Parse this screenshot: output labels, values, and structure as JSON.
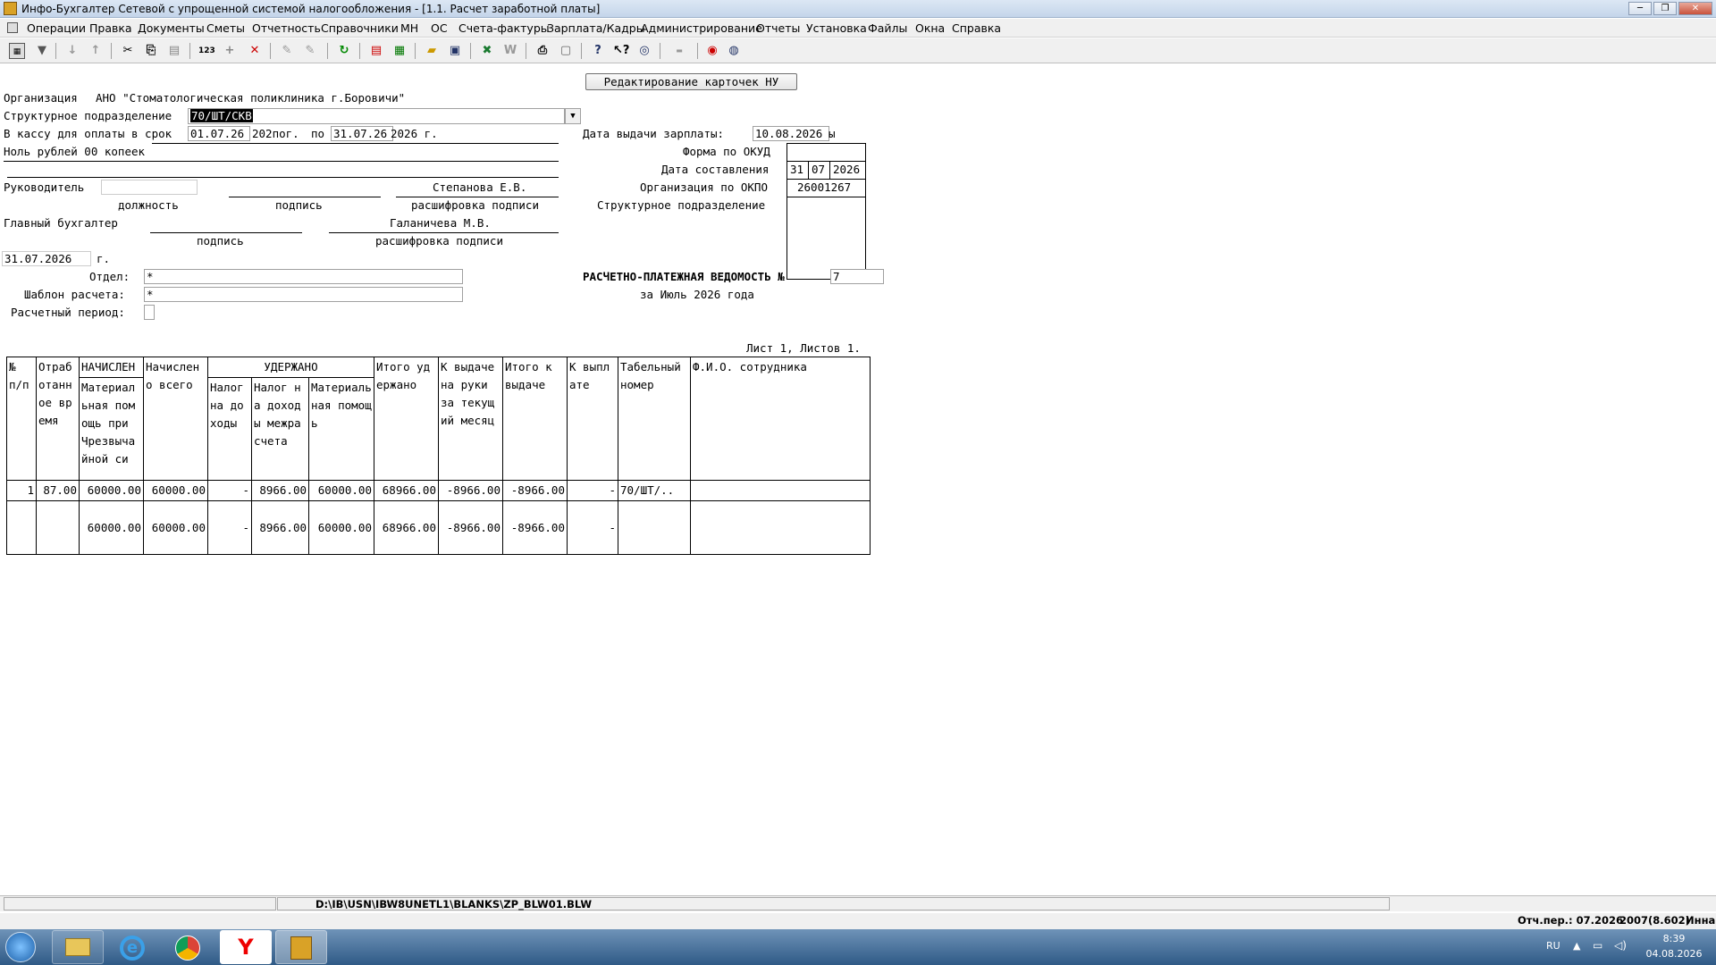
{
  "window": {
    "title": "Инфо-Бухгалтер Сетевой с упрощенной системой налогообложения - [1.1. Расчет заработной платы]",
    "minimize": "─",
    "restore": "❐",
    "close": "✕"
  },
  "menu": [
    "Операции",
    "Правка",
    "Документы",
    "Сметы",
    "Отчетность",
    "Справочники",
    "МН",
    "ОС",
    "Счета-фактуры",
    "Зарплата/Кадры",
    "Администрирование",
    "Отчеты",
    "Установка",
    "Файлы",
    "Окна",
    "Справка"
  ],
  "form": {
    "button_edit_cards": "Редактирование карточек НУ",
    "org_label": "Организация",
    "org_value": "АНО \"Стоматологическая поликлиника г.Боровичи\"",
    "dept_label": "Структурное подразделение",
    "dept_value": "70/ШТ/СКВ",
    "cash_label": "В кассу для оплаты в срок",
    "date_from": "01.07.26",
    "year_from": "202пог.",
    "po": "по",
    "date_to": "31.07.26",
    "year_to": "2026 г.",
    "amount_words": "Ноль рублей 00 копеек",
    "pay_date_label": "Дата выдачи зарплаты:",
    "pay_date": "10.08.2026",
    "pay_date_tail": "ы",
    "okud_label": "Форма по ОКУД",
    "date_comp_label": "Дата составления",
    "date_comp_d": "31",
    "date_comp_m": "07",
    "date_comp_y": "2026",
    "okpo_label": "Организация по ОКПО",
    "okpo_value": "26001267",
    "struct_label": "Структурное подразделение",
    "head_label": "Руководитель",
    "head_name": "Степанова Е.В.",
    "position_cap": "должность",
    "signature_cap": "подпись",
    "decode_cap": "расшифровка подписи",
    "chief_label": "Главный бухгалтер",
    "chief_name": "Галаничева М.В.",
    "signature_cap2": "подпись",
    "decode_cap2": "расшифровка подписи",
    "sign_date": "31.07.2026",
    "sign_date_g": "г.",
    "otdel_label": "Отдел:",
    "otdel_value": "*",
    "template_label": "Шаблон расчета:",
    "template_value": "*",
    "period_label": "Расчетный период:",
    "statement_title": "РАСЧЕТНО-ПЛАТЕЖНАЯ ВЕДОМОСТЬ №",
    "statement_no": "7",
    "statement_period": "за Июль 2026 года",
    "sheet_info": "Лист 1, Листов 1."
  },
  "table": {
    "h_no": "№ п/п",
    "h_worked": "Отработанное время",
    "h_accrued": "НАЧИСЛЕН",
    "h_matpom": "Материальная помощь при Чрезвычайной си",
    "h_accrued_total": "Начислено всего",
    "h_withheld": "УДЕРЖАНО",
    "h_tax1": "Налог на доходы",
    "h_tax2": "Налог на доходы межрасчета",
    "h_matpom2": "Материальная помощь",
    "h_withheld_total": "Итого удержано",
    "h_to_pay": "К выдаче на руки за текущий месяц",
    "h_total_pay": "Итого к выдаче",
    "h_paid": "К выплате",
    "h_tabno": "Табельный номер",
    "h_fio": "Ф.И.О. сотрудника",
    "row": [
      "1",
      "87.00",
      "60000.00",
      "60000.00",
      "-",
      "8966.00",
      "60000.00",
      "68966.00",
      "-8966.00",
      "-8966.00",
      "-",
      "70/ШТ/..",
      ""
    ],
    "total": [
      "",
      "",
      "60000.00",
      "60000.00",
      "-",
      "8966.00",
      "60000.00",
      "68966.00",
      "-8966.00",
      "-8966.00",
      "-",
      "",
      ""
    ]
  },
  "status": {
    "path": "D:\\IB\\USN\\IBW8UNETL1\\BLANKS\\ZP_BLW01.BLW",
    "period": "Отч.пер.: 07.2026",
    "version": "2007(8.602)",
    "user": "Инна"
  },
  "taskbar": {
    "lang": "RU",
    "time": "8:39",
    "date": "04.08.2026"
  }
}
